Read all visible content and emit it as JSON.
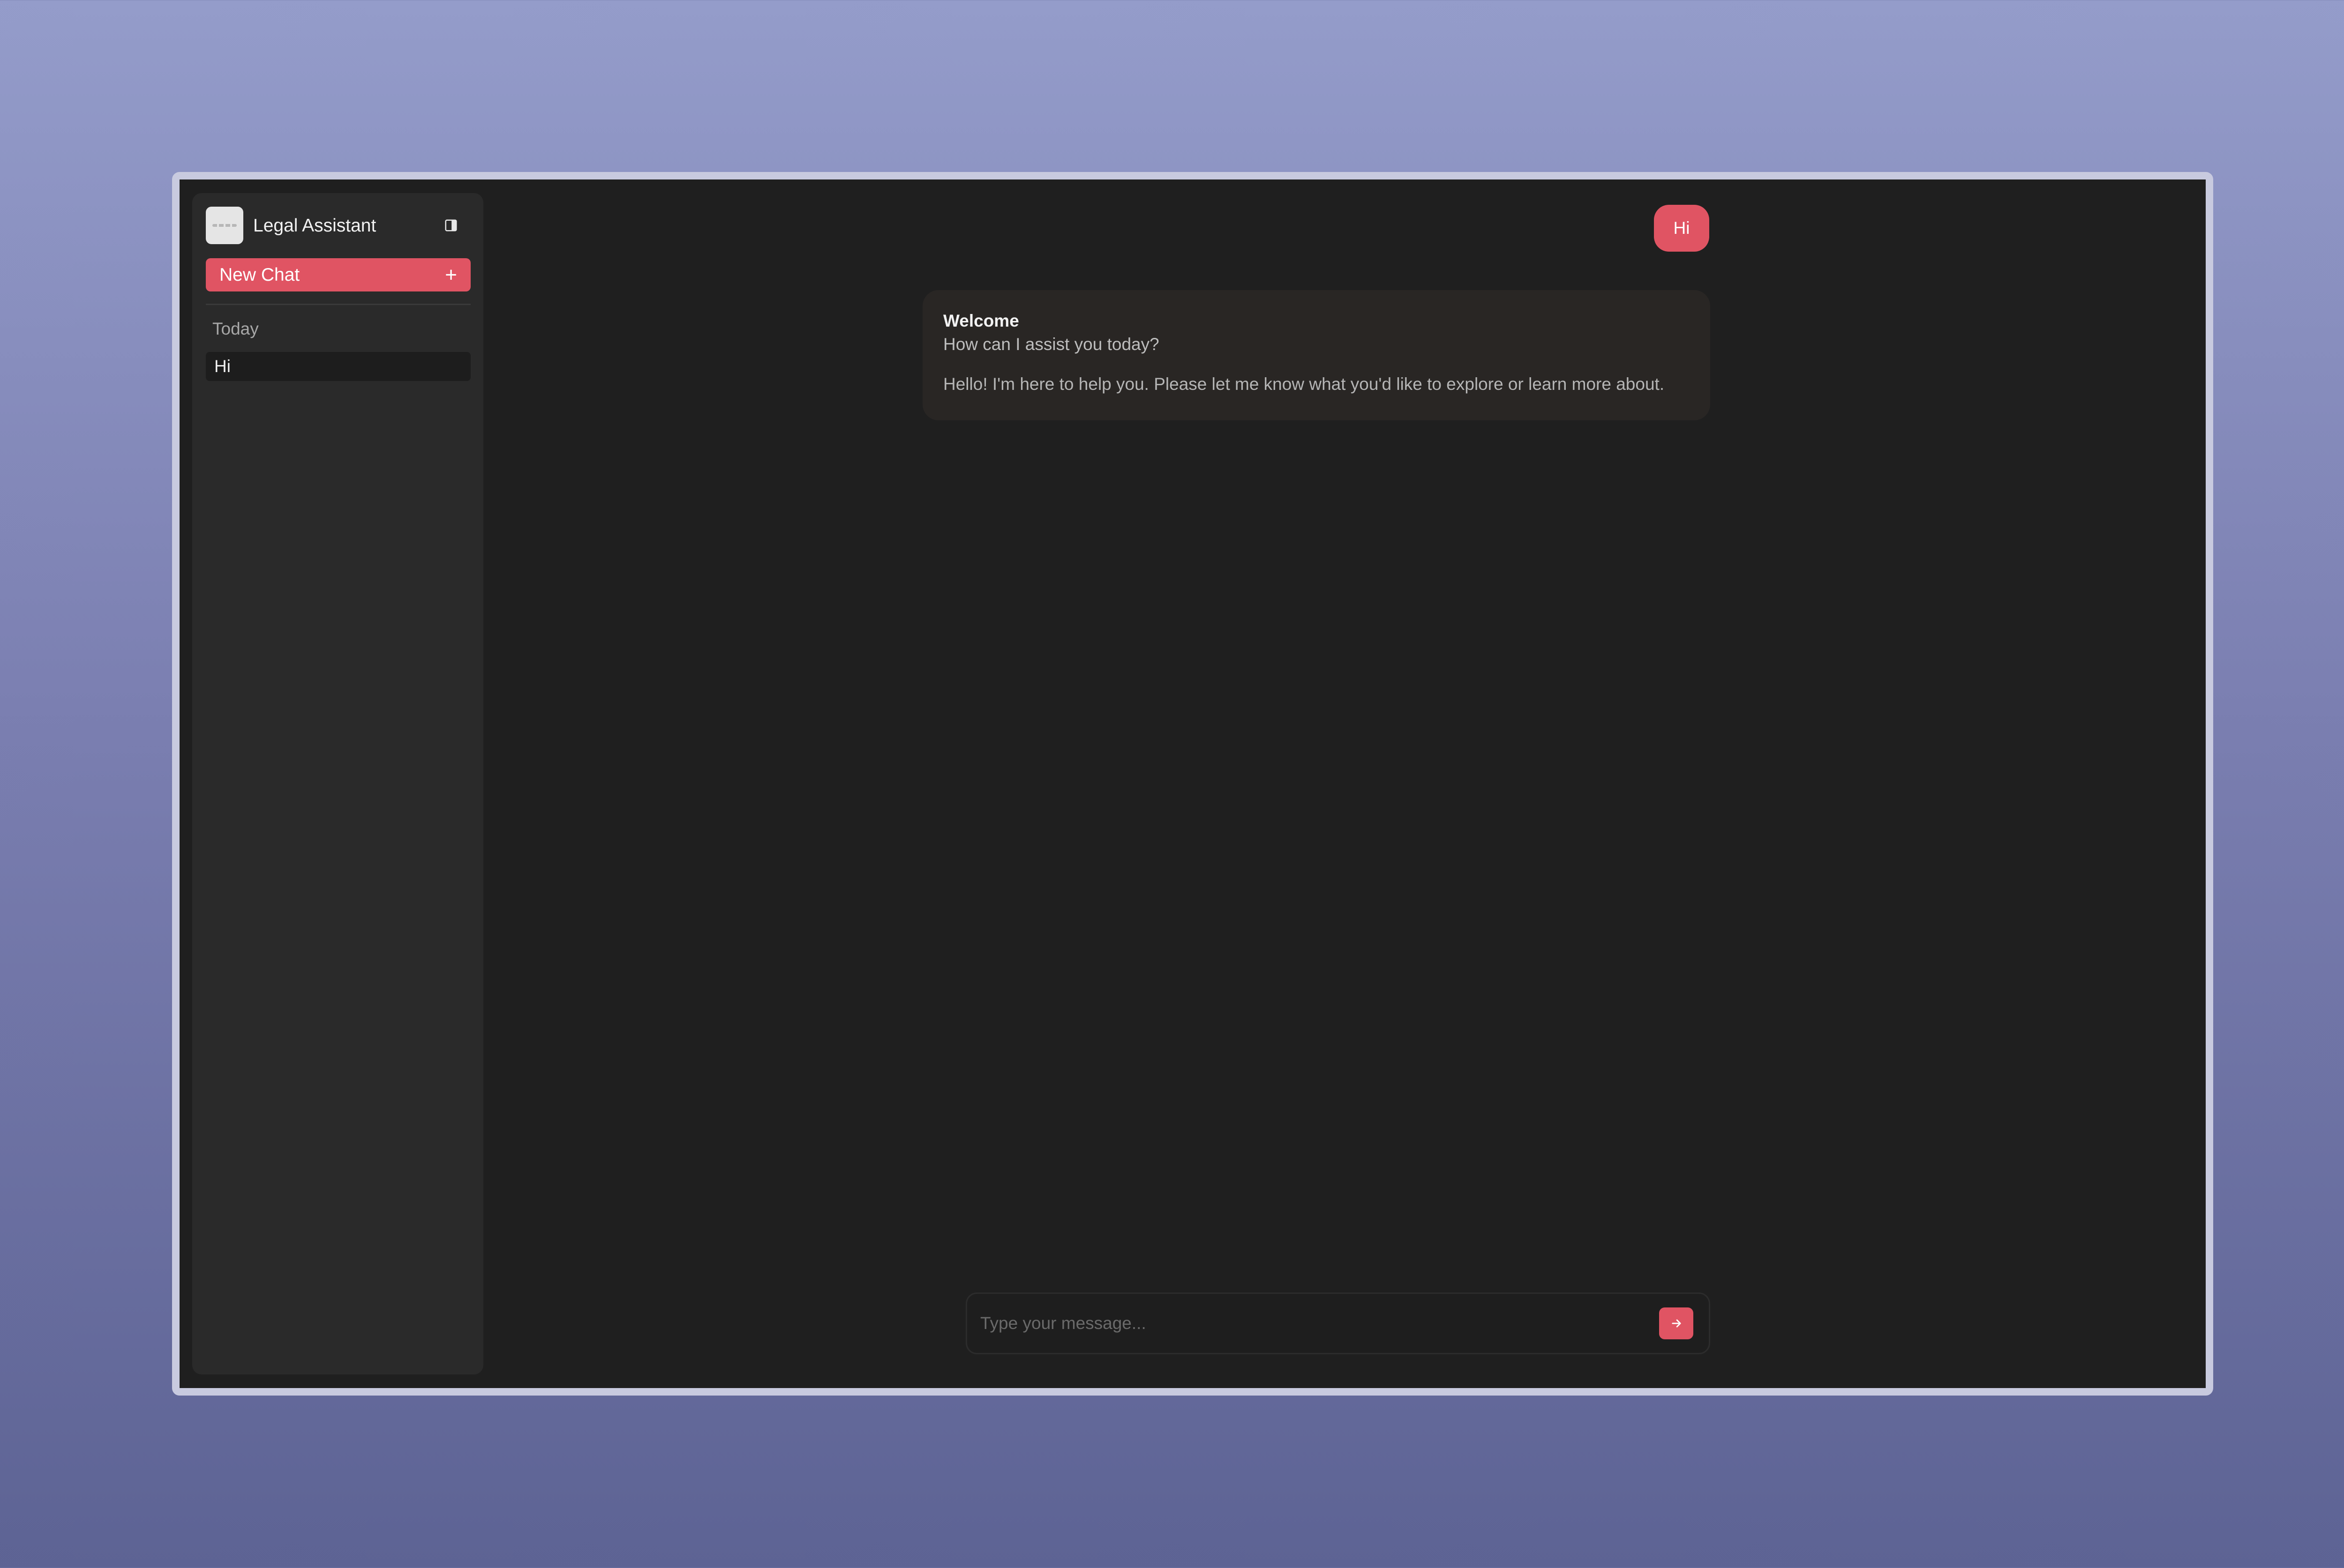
{
  "app": {
    "title": "Legal Assistant"
  },
  "sidebar": {
    "new_chat_label": "New Chat",
    "section_label": "Today",
    "history": [
      {
        "label": "Hi"
      }
    ]
  },
  "chat": {
    "user_message": "Hi",
    "welcome": {
      "title": "Welcome",
      "subtitle": "How can I assist you today?",
      "message": "Hello! I'm here to help you. Please let me know what you'd like to explore or learn more about."
    }
  },
  "composer": {
    "placeholder": "Type your message...",
    "value": ""
  },
  "icons": {
    "toggle": "sidebar-toggle-icon",
    "plus": "plus-icon",
    "send": "arrow-right-icon"
  },
  "colors": {
    "accent": "#e05463",
    "background": "#1f1f1f",
    "sidebar": "#2a2a2a",
    "card": "#292624",
    "frame_border": "#c8cadf"
  }
}
